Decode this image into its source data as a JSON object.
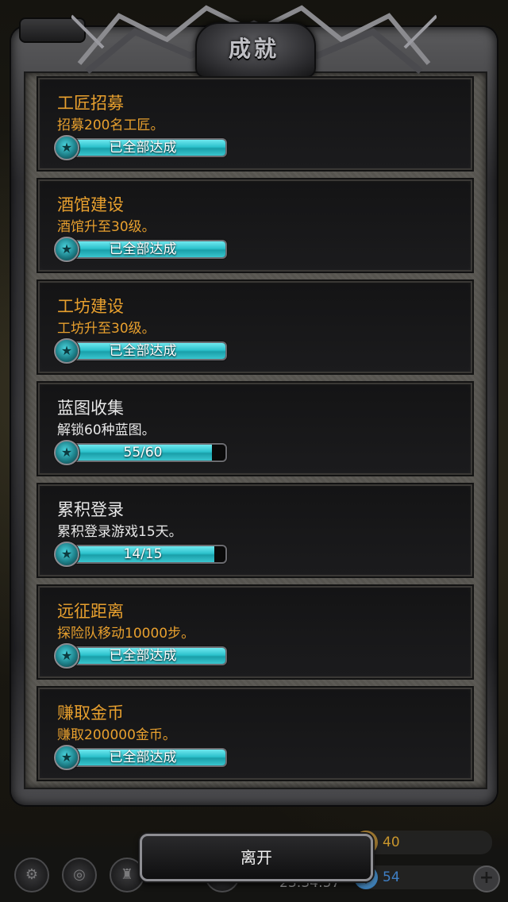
{
  "header": {
    "title": "成就"
  },
  "achievements": [
    {
      "title": "工匠招募",
      "description": "招募200名工匠。",
      "progress_label": "已全部达成",
      "progress": 1.0,
      "completed": true
    },
    {
      "title": "酒馆建设",
      "description": "酒馆升至30级。",
      "progress_label": "已全部达成",
      "progress": 1.0,
      "completed": true
    },
    {
      "title": "工坊建设",
      "description": "工坊升至30级。",
      "progress_label": "已全部达成",
      "progress": 1.0,
      "completed": true
    },
    {
      "title": "蓝图收集",
      "description": "解锁60种蓝图。",
      "progress_label": "55/60",
      "progress": 0.9167,
      "completed": false
    },
    {
      "title": "累积登录",
      "description": "累积登录游戏15天。",
      "progress_label": "14/15",
      "progress": 0.9333,
      "completed": false
    },
    {
      "title": "远征距离",
      "description": "探险队移动10000步。",
      "progress_label": "已全部达成",
      "progress": 1.0,
      "completed": true
    },
    {
      "title": "赚取金币",
      "description": "赚取200000金币。",
      "progress_label": "已全部达成",
      "progress": 1.0,
      "completed": true
    }
  ],
  "footer": {
    "leave_label": "离开",
    "clock": "23:34:57",
    "gold_value": "40",
    "gem_value": "54"
  },
  "colors": {
    "completed_title": "#e8a02e",
    "incomplete_title": "#e8e8e8",
    "progress_fill": "#2cc2cc"
  },
  "icons": {
    "badge": "star-icon",
    "gold": "coin-icon",
    "gem": "gem-icon",
    "plus": "plus-icon"
  }
}
